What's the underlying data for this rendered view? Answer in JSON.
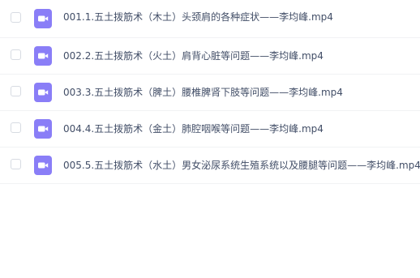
{
  "colors": {
    "icon_background": "#8a7ef7",
    "text": "#424e67",
    "divider": "#f1f2f4",
    "checkbox_border": "#d7dbe2"
  },
  "files": [
    {
      "name": "001.1.五土拨筋术（木土）头颈肩的各种症状——李均峰.mp4",
      "icon": "video-file-icon"
    },
    {
      "name": "002.2.五土拨筋术（火土）肩背心脏等问题——李均峰.mp4",
      "icon": "video-file-icon"
    },
    {
      "name": "003.3.五土拨筋术（脾土）腰椎脾肾下肢等问题——李均峰.mp4",
      "icon": "video-file-icon"
    },
    {
      "name": "004.4.五土拨筋术（金土）肺腔咽喉等问题——李均峰.mp4",
      "icon": "video-file-icon"
    },
    {
      "name": "005.5.五土拨筋术（水土）男女泌尿系统生殖系统以及腰腿等问题——李均峰.mp4",
      "icon": "video-file-icon"
    }
  ]
}
